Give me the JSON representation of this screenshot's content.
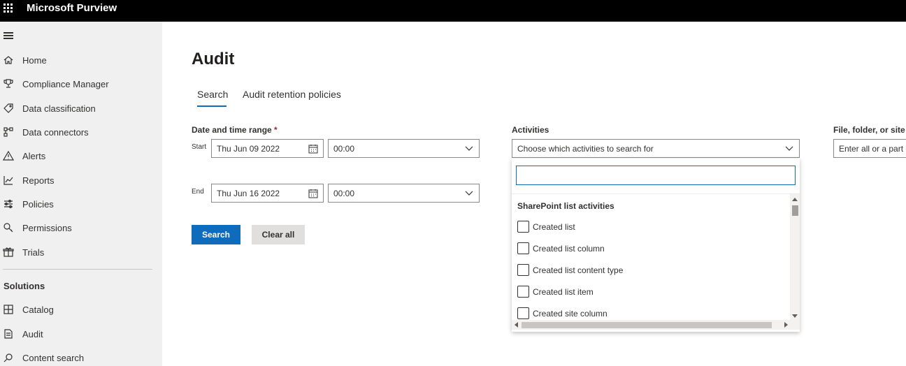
{
  "app": {
    "title": "Microsoft Purview"
  },
  "sidebar": {
    "items": [
      {
        "label": "Home",
        "icon": "home-icon"
      },
      {
        "label": "Compliance Manager",
        "icon": "trophy-icon"
      },
      {
        "label": "Data classification",
        "icon": "tag-icon"
      },
      {
        "label": "Data connectors",
        "icon": "connector-icon"
      },
      {
        "label": "Alerts",
        "icon": "warning-icon"
      },
      {
        "label": "Reports",
        "icon": "chart-icon"
      },
      {
        "label": "Policies",
        "icon": "sliders-icon"
      },
      {
        "label": "Permissions",
        "icon": "key-icon"
      },
      {
        "label": "Trials",
        "icon": "gift-icon"
      }
    ],
    "solutions_label": "Solutions",
    "solutions": [
      {
        "label": "Catalog",
        "icon": "grid-icon"
      },
      {
        "label": "Audit",
        "icon": "audit-icon"
      },
      {
        "label": "Content search",
        "icon": "search-icon"
      }
    ]
  },
  "page": {
    "title": "Audit",
    "tabs": [
      {
        "label": "Search"
      },
      {
        "label": "Audit retention policies"
      }
    ],
    "active_tab": "Search"
  },
  "form": {
    "date_label": "Date and time range",
    "required_marker": "*",
    "start_label": "Start",
    "end_label": "End",
    "start_date": "Thu Jun 09 2022",
    "start_time": "00:00",
    "end_date": "Thu Jun 16 2022",
    "end_time": "00:00",
    "activities_label": "Activities",
    "activities_placeholder": "Choose which activities to search for",
    "file_label": "File, folder, or site",
    "file_placeholder": "Enter all or a part o",
    "search_button": "Search",
    "clear_button": "Clear all"
  },
  "dropdown": {
    "search_value": "",
    "group": "SharePoint list activities",
    "options": [
      {
        "label": "Created list",
        "checked": false
      },
      {
        "label": "Created list column",
        "checked": false
      },
      {
        "label": "Created list content type",
        "checked": false
      },
      {
        "label": "Created list item",
        "checked": false
      },
      {
        "label": "Created site column",
        "checked": false
      }
    ]
  },
  "colors": {
    "accent": "#0f6cbd",
    "topbar": "#000000",
    "sidebar": "#f0f0f0"
  }
}
